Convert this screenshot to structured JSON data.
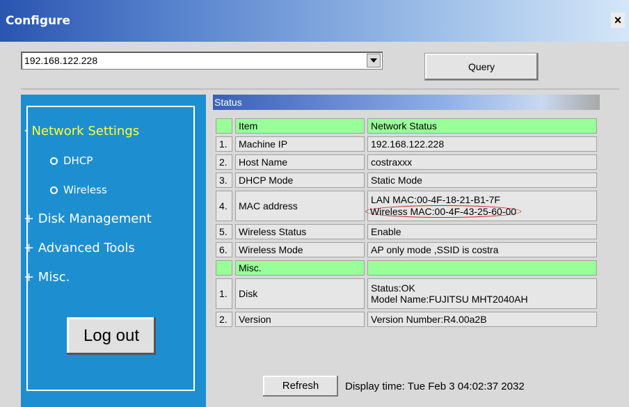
{
  "window": {
    "title": "Configure",
    "close_glyph": "×"
  },
  "toolbar": {
    "host_value": "192.168.122.228",
    "query_label": "Query"
  },
  "sidebar": {
    "items": [
      {
        "label": "· Network Settings"
      },
      {
        "label": "DHCP"
      },
      {
        "label": "Wireless"
      },
      {
        "label": "+ Disk Management"
      },
      {
        "label": "+ Advanced Tools"
      },
      {
        "label": "+ Misc."
      }
    ],
    "logout_label": "Log out"
  },
  "status": {
    "header": "Status",
    "col_item": "Item",
    "col_status": "Network Status",
    "rows": [
      {
        "num": "1.",
        "item": "Machine IP",
        "value": "192.168.122.228"
      },
      {
        "num": "2.",
        "item": "Host Name",
        "value": "costraxxx"
      },
      {
        "num": "3.",
        "item": "DHCP Mode",
        "value": "Static Mode"
      },
      {
        "num": "4.",
        "item": "MAC address",
        "value": "LAN MAC:00-4F-18-21-B1-7F",
        "value2": "Wireless MAC:00-4F-43-25-60-00"
      },
      {
        "num": "5.",
        "item": "Wireless Status",
        "value": "Enable"
      },
      {
        "num": "6.",
        "item": "Wireless Mode",
        "value": "AP only mode ,SSID is costra"
      }
    ],
    "misc_header": "Misc.",
    "misc_rows": [
      {
        "num": "1.",
        "item": "Disk",
        "value": "Status:OK",
        "value2": "Model Name:FUJITSU MHT2040AH"
      },
      {
        "num": "2.",
        "item": "Version",
        "value": "Version Number:R4.00a2B"
      }
    ]
  },
  "footer": {
    "refresh_label": "Refresh",
    "display_time": "Display time: Tue Feb 3 04:02:37 2032"
  },
  "colors": {
    "sidebar_bg": "#1d8fd1",
    "active_nav": "#ffff33",
    "header_row": "#99ff99",
    "annotation": "#d42020"
  }
}
